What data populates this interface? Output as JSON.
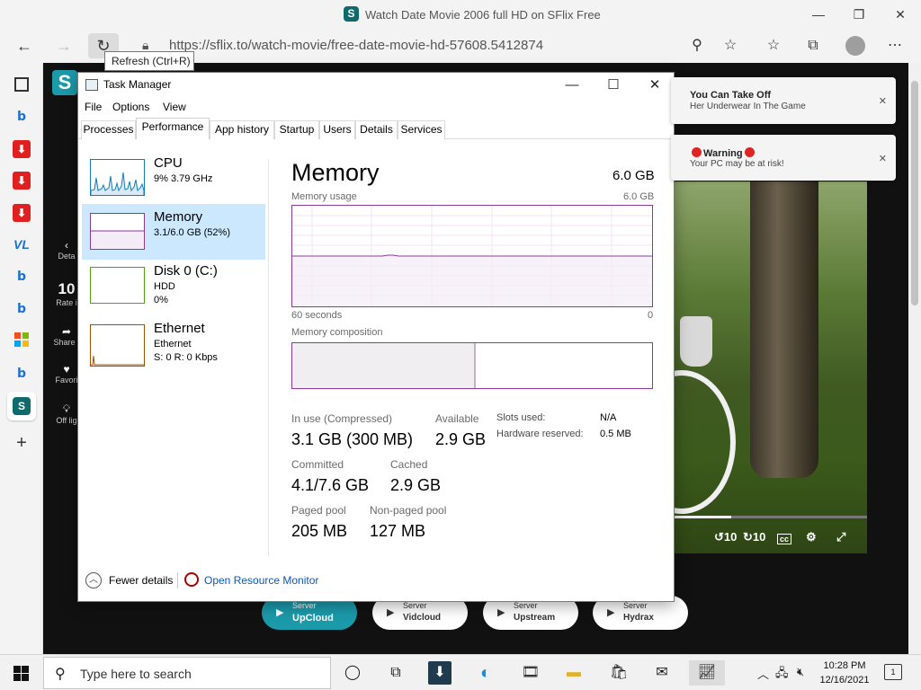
{
  "browser": {
    "window_title": "Watch Date Movie 2006 full HD on SFlix Free",
    "logo_letter": "S",
    "url": "https://sflix.to/watch-movie/free-date-movie-hd-57608.5412874",
    "tooltip": "Refresh (Ctrl+R)"
  },
  "sidebar_icons": [
    "video-icon",
    "bing-icon",
    "download-icon",
    "download-icon",
    "download-icon",
    "vl-icon",
    "bing-icon",
    "bing-icon",
    "windows-logo-icon",
    "bing-icon",
    "sflix-icon",
    "plus-icon"
  ],
  "webpage": {
    "logo": "S",
    "side": {
      "detail": "Deta",
      "rating_value": "10",
      "rating_label": "Rate i",
      "share": "Share t",
      "favorite": "Favori",
      "offlight": "Off lig"
    },
    "servers": [
      {
        "label": "Server",
        "name": "UpCloud",
        "active": true
      },
      {
        "label": "Server",
        "name": "Vidcloud",
        "active": false
      },
      {
        "label": "Server",
        "name": "Upstream",
        "active": false
      },
      {
        "label": "Server",
        "name": "Hydrax",
        "active": false
      }
    ],
    "video": {
      "progress_fraction": 0.3,
      "controls": [
        "10",
        "10",
        "cc-icon",
        "gear-icon",
        "fullscreen-icon"
      ]
    },
    "notifications": [
      {
        "title": "You Can Take Off",
        "text": "Her Underwear In The Game"
      },
      {
        "title": "Warning",
        "text": "Your PC may be at risk!"
      }
    ]
  },
  "task_manager": {
    "title": "Task Manager",
    "menu": [
      "File",
      "Options",
      "View"
    ],
    "tabs": [
      "Processes",
      "Performance",
      "App history",
      "Startup",
      "Users",
      "Details",
      "Services"
    ],
    "active_tab": "Performance",
    "items": [
      {
        "name": "CPU",
        "line1": "9% 3.79 GHz",
        "line2": "",
        "line3": ""
      },
      {
        "name": "Memory",
        "line1": "3.1/6.0 GB (52%)",
        "line2": "",
        "line3": ""
      },
      {
        "name": "Disk 0 (C:)",
        "line1": "HDD",
        "line2": "0%",
        "line3": ""
      },
      {
        "name": "Ethernet",
        "line1": "Ethernet",
        "line2": "S: 0 R: 0 Kbps",
        "line3": ""
      }
    ],
    "memory": {
      "title": "Memory",
      "total": "6.0 GB",
      "usage_label": "Memory usage",
      "usage_max": "6.0 GB",
      "time_left": "60 seconds",
      "time_right": "0",
      "composition_label": "Memory composition",
      "in_use_fraction": 0.51,
      "stats": {
        "in_use_label": "In use (Compressed)",
        "in_use_value": "3.1 GB (300 MB)",
        "available_label": "Available",
        "available_value": "2.9 GB",
        "slots_label": "Slots used:",
        "slots_value": "N/A",
        "hw_label": "Hardware reserved:",
        "hw_value": "0.5 MB",
        "committed_label": "Committed",
        "committed_value": "4.1/7.6 GB",
        "cached_label": "Cached",
        "cached_value": "2.9 GB",
        "paged_label": "Paged pool",
        "paged_value": "205 MB",
        "nonpaged_label": "Non-paged pool",
        "nonpaged_value": "127 MB"
      }
    },
    "footer": {
      "fewer_details": "Fewer details",
      "open_resource_monitor": "Open Resource Monitor"
    },
    "colors": {
      "memory_border": "#8b3a9b",
      "cpu_line": "#117dbb",
      "disk_line": "#4da60c",
      "ethernet_line": "#a74f01",
      "selected_bg": "#cce8ff"
    }
  },
  "taskbar": {
    "search_placeholder": "Type here to search",
    "time": "10:28 PM",
    "date": "12/16/2021",
    "notification_count": "1"
  }
}
